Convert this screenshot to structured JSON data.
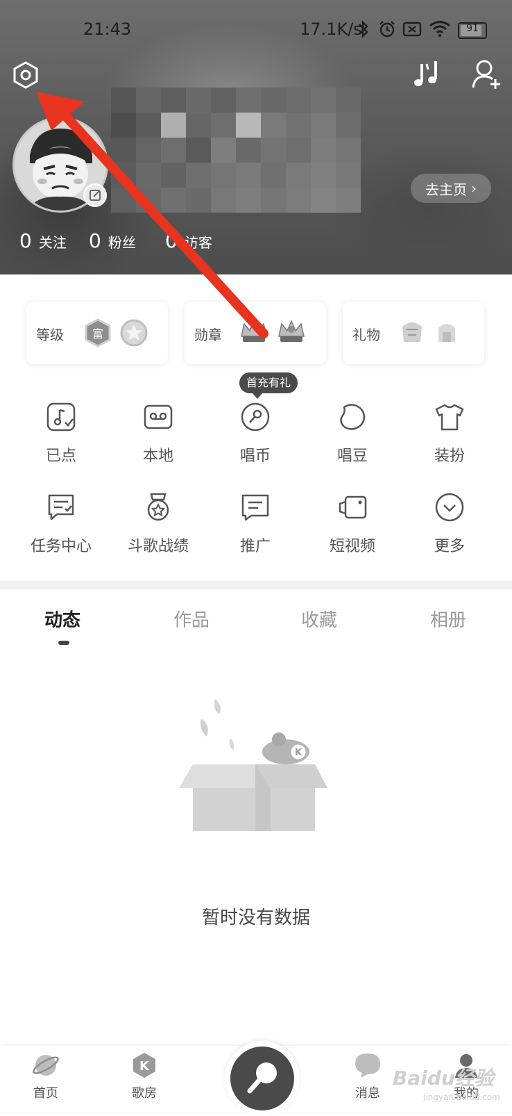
{
  "status_bar": {
    "time": "21:43",
    "network_speed": "17.1K/s",
    "battery": "91",
    "icons": [
      "bluetooth-icon",
      "alarm-icon",
      "sim-icon",
      "wifi-icon",
      "battery-icon"
    ]
  },
  "header": {
    "settings_icon": "settings-hexagon-icon",
    "music_icon": "music-notes-icon",
    "add_friend_icon": "add-user-icon",
    "homepage_button": "去主页",
    "stats": [
      {
        "count": "0",
        "label": "关注"
      },
      {
        "count": "0",
        "label": "粉丝"
      },
      {
        "count": "0",
        "label": "访客"
      }
    ]
  },
  "cards": [
    {
      "title": "等级",
      "badges": [
        "富",
        "star"
      ]
    },
    {
      "title": "勋章",
      "badges": [
        "crown",
        "crown"
      ]
    },
    {
      "title": "礼物",
      "badges": [
        "gift",
        "gift"
      ]
    }
  ],
  "promo_badge": "首充有礼",
  "grid": [
    {
      "label": "已点",
      "icon": "music-note-check-icon"
    },
    {
      "label": "本地",
      "icon": "cassette-icon"
    },
    {
      "label": "唱币",
      "icon": "coin-mic-icon"
    },
    {
      "label": "唱豆",
      "icon": "bean-icon"
    },
    {
      "label": "装扮",
      "icon": "tshirt-icon"
    },
    {
      "label": "任务中心",
      "icon": "task-icon"
    },
    {
      "label": "斗歌战绩",
      "icon": "medal-icon"
    },
    {
      "label": "推广",
      "icon": "message-icon"
    },
    {
      "label": "短视频",
      "icon": "video-icon"
    },
    {
      "label": "更多",
      "icon": "chevron-circle-icon"
    }
  ],
  "tabs": [
    {
      "label": "动态",
      "active": true
    },
    {
      "label": "作品",
      "active": false
    },
    {
      "label": "收藏",
      "active": false
    },
    {
      "label": "相册",
      "active": false
    }
  ],
  "empty_state": "暂时没有数据",
  "bottom_nav": [
    {
      "label": "首页",
      "icon": "planet-icon"
    },
    {
      "label": "歌房",
      "icon": "k-room-icon"
    },
    {
      "label": "",
      "icon": "microphone-icon"
    },
    {
      "label": "消息",
      "icon": "chat-bubble-icon"
    },
    {
      "label": "我的",
      "icon": "profile-icon"
    }
  ],
  "watermark": "Baidu经验",
  "watermark_sub": "jingyan.baidu.com",
  "colors": {
    "arrow": "#e8331f",
    "header_bg": "#5c5c5c",
    "text_primary": "#333333",
    "text_muted": "#9a9a9a"
  }
}
